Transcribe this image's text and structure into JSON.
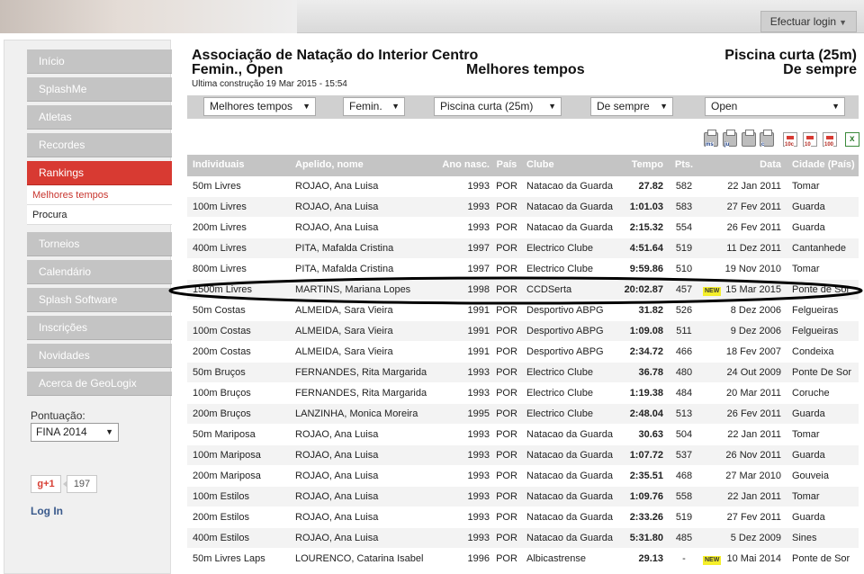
{
  "header": {
    "login_label": "Efectuar login"
  },
  "sidebar": {
    "items": [
      {
        "label": "Início"
      },
      {
        "label": "SplashMe"
      },
      {
        "label": "Atletas"
      },
      {
        "label": "Recordes"
      },
      {
        "label": "Rankings",
        "active": true
      }
    ],
    "subitems": [
      {
        "label": "Melhores tempos",
        "active": true
      },
      {
        "label": "Procura"
      }
    ],
    "items2": [
      {
        "label": "Torneios"
      },
      {
        "label": "Calendário"
      },
      {
        "label": "Splash Software"
      },
      {
        "label": "Inscrições"
      },
      {
        "label": "Novidades"
      },
      {
        "label": "Acerca de GeoLogix"
      }
    ],
    "pontuacao_label": "Pontuação:",
    "pontuacao_value": "FINA 2014",
    "gplus_label": "g+1",
    "gplus_count": "197",
    "login_link": "Log In"
  },
  "page": {
    "org": "Associação de Natação do Interior Centro",
    "subtitle": "Femin., Open",
    "center_title": "Melhores tempos",
    "right_title1": "Piscina curta (25m)",
    "right_title2": "De sempre",
    "built": "Ultima construção 19 Mar 2015 - 15:54"
  },
  "filters": {
    "type": "Melhores tempos",
    "gender": "Femin.",
    "course": "Piscina curta (25m)",
    "period": "De sempre",
    "age": "Open"
  },
  "export_icons": [
    {
      "icon": "printer-ms-icon",
      "tag": "ms"
    },
    {
      "icon": "printer-ju-icon",
      "tag": "ju"
    },
    {
      "icon": "printer-icon",
      "tag": ""
    },
    {
      "icon": "printer-c-icon",
      "tag": "c"
    },
    {
      "icon": "pdf-10c-icon",
      "tag": "10c"
    },
    {
      "icon": "pdf-10-icon",
      "tag": "10"
    },
    {
      "icon": "pdf-100-icon",
      "tag": "100"
    },
    {
      "icon": "excel-icon",
      "tag": ""
    }
  ],
  "table": {
    "columns": {
      "event": "Individuais",
      "name": "Apelido, nome",
      "year": "Ano nasc.",
      "country": "País",
      "club": "Clube",
      "time": "Tempo",
      "points": "Pts.",
      "date": "Data",
      "city": "Cidade (País)"
    },
    "new_label": "NEW",
    "rows": [
      {
        "event": "50m Livres",
        "name": "ROJAO, Ana Luisa",
        "year": "1993",
        "country": "POR",
        "club": "Natacao da Guarda",
        "time": "27.82",
        "points": "582",
        "new": false,
        "date": "22 Jan 2011",
        "city": "Tomar"
      },
      {
        "event": "100m Livres",
        "name": "ROJAO, Ana Luisa",
        "year": "1993",
        "country": "POR",
        "club": "Natacao da Guarda",
        "time": "1:01.03",
        "points": "583",
        "new": false,
        "date": "27 Fev 2011",
        "city": "Guarda"
      },
      {
        "event": "200m Livres",
        "name": "ROJAO, Ana Luisa",
        "year": "1993",
        "country": "POR",
        "club": "Natacao da Guarda",
        "time": "2:15.32",
        "points": "554",
        "new": false,
        "date": "26 Fev 2011",
        "city": "Guarda"
      },
      {
        "event": "400m Livres",
        "name": "PITA, Mafalda Cristina",
        "year": "1997",
        "country": "POR",
        "club": "Electrico Clube",
        "time": "4:51.64",
        "points": "519",
        "new": false,
        "date": "11 Dez 2011",
        "city": "Cantanhede"
      },
      {
        "event": "800m Livres",
        "name": "PITA, Mafalda Cristina",
        "year": "1997",
        "country": "POR",
        "club": "Electrico Clube",
        "time": "9:59.86",
        "points": "510",
        "new": false,
        "date": "19 Nov 2010",
        "city": "Tomar"
      },
      {
        "event": "1500m Livres",
        "name": "MARTINS, Mariana Lopes",
        "year": "1998",
        "country": "POR",
        "club": "CCDSerta",
        "time": "20:02.87",
        "points": "457",
        "new": true,
        "date": "15 Mar 2015",
        "city": "Ponte de Sor"
      },
      {
        "event": "50m Costas",
        "name": "ALMEIDA, Sara Vieira",
        "year": "1991",
        "country": "POR",
        "club": "Desportivo ABPG",
        "time": "31.82",
        "points": "526",
        "new": false,
        "date": "8 Dez 2006",
        "city": "Felgueiras"
      },
      {
        "event": "100m Costas",
        "name": "ALMEIDA, Sara Vieira",
        "year": "1991",
        "country": "POR",
        "club": "Desportivo ABPG",
        "time": "1:09.08",
        "points": "511",
        "new": false,
        "date": "9 Dez 2006",
        "city": "Felgueiras"
      },
      {
        "event": "200m Costas",
        "name": "ALMEIDA, Sara Vieira",
        "year": "1991",
        "country": "POR",
        "club": "Desportivo ABPG",
        "time": "2:34.72",
        "points": "466",
        "new": false,
        "date": "18 Fev 2007",
        "city": "Condeixa"
      },
      {
        "event": "50m Bruços",
        "name": "FERNANDES, Rita Margarida",
        "year": "1993",
        "country": "POR",
        "club": "Electrico Clube",
        "time": "36.78",
        "points": "480",
        "new": false,
        "date": "24 Out 2009",
        "city": "Ponte De Sor"
      },
      {
        "event": "100m Bruços",
        "name": "FERNANDES, Rita Margarida",
        "year": "1993",
        "country": "POR",
        "club": "Electrico Clube",
        "time": "1:19.38",
        "points": "484",
        "new": false,
        "date": "20 Mar 2011",
        "city": "Coruche"
      },
      {
        "event": "200m Bruços",
        "name": "LANZINHA, Monica Moreira",
        "year": "1995",
        "country": "POR",
        "club": "Electrico Clube",
        "time": "2:48.04",
        "points": "513",
        "new": false,
        "date": "26 Fev 2011",
        "city": "Guarda"
      },
      {
        "event": "50m Mariposa",
        "name": "ROJAO, Ana Luisa",
        "year": "1993",
        "country": "POR",
        "club": "Natacao da Guarda",
        "time": "30.63",
        "points": "504",
        "new": false,
        "date": "22 Jan 2011",
        "city": "Tomar"
      },
      {
        "event": "100m Mariposa",
        "name": "ROJAO, Ana Luisa",
        "year": "1993",
        "country": "POR",
        "club": "Natacao da Guarda",
        "time": "1:07.72",
        "points": "537",
        "new": false,
        "date": "26 Nov 2011",
        "city": "Guarda"
      },
      {
        "event": "200m Mariposa",
        "name": "ROJAO, Ana Luisa",
        "year": "1993",
        "country": "POR",
        "club": "Natacao da Guarda",
        "time": "2:35.51",
        "points": "468",
        "new": false,
        "date": "27 Mar 2010",
        "city": "Gouveia"
      },
      {
        "event": "100m Estilos",
        "name": "ROJAO, Ana Luisa",
        "year": "1993",
        "country": "POR",
        "club": "Natacao da Guarda",
        "time": "1:09.76",
        "points": "558",
        "new": false,
        "date": "22 Jan 2011",
        "city": "Tomar"
      },
      {
        "event": "200m Estilos",
        "name": "ROJAO, Ana Luisa",
        "year": "1993",
        "country": "POR",
        "club": "Natacao da Guarda",
        "time": "2:33.26",
        "points": "519",
        "new": false,
        "date": "27 Fev 2011",
        "city": "Guarda"
      },
      {
        "event": "400m Estilos",
        "name": "ROJAO, Ana Luisa",
        "year": "1993",
        "country": "POR",
        "club": "Natacao da Guarda",
        "time": "5:31.80",
        "points": "485",
        "new": false,
        "date": "5 Dez 2009",
        "city": "Sines"
      },
      {
        "event": "50m Livres Laps",
        "name": "LOURENCO, Catarina Isabel",
        "year": "1996",
        "country": "POR",
        "club": "Albicastrense",
        "time": "29.13",
        "points": "-",
        "new": true,
        "date": "10 Mai 2014",
        "city": "Ponte de Sor"
      }
    ]
  }
}
